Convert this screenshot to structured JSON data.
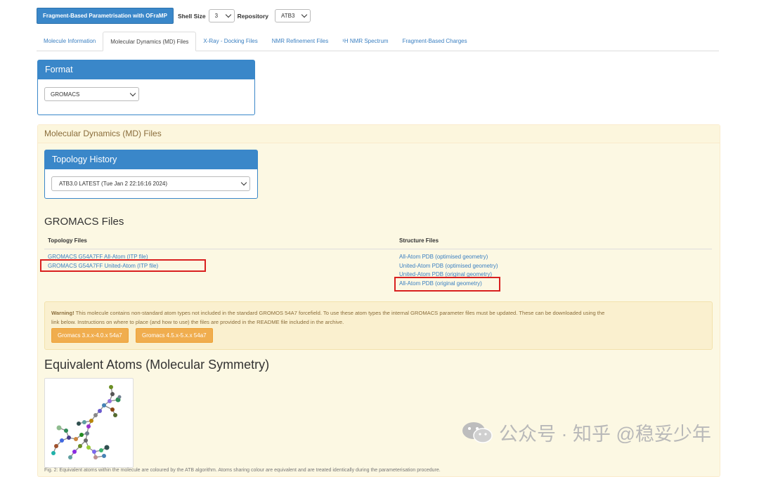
{
  "toolbar": {
    "fragment_button": "Fragment-Based Parametrisation with OFraMP",
    "shell_size_label": "Shell Size",
    "shell_size_value": "3",
    "repository_label": "Repository",
    "repository_value": "ATB3"
  },
  "tabs": [
    {
      "label": "Molecule Information",
      "active": false
    },
    {
      "label": "Molecular Dynamics (MD) Files",
      "active": true
    },
    {
      "label": "X-Ray - Docking Files",
      "active": false
    },
    {
      "label": "NMR Refinement Files",
      "active": false
    },
    {
      "label": "¹H NMR Spectrum",
      "active": false
    },
    {
      "label": "Fragment-Based Charges",
      "active": false
    }
  ],
  "format": {
    "title": "Format",
    "value": "GROMACS"
  },
  "md_panel": {
    "title": "Molecular Dynamics (MD) Files"
  },
  "topology_history": {
    "title": "Topology History",
    "value": "ATB3.0 LATEST (Tue Jan 2 22:16:16 2024)"
  },
  "gromacs_files": {
    "title": "GROMACS Files",
    "topology_header": "Topology Files",
    "structure_header": "Structure Files",
    "topology_links": [
      "GROMACS G54A7FF All-Atom (ITP file)",
      "GROMACS G54A7FF United-Atom (ITP file)"
    ],
    "structure_links": [
      "All-Atom PDB (optimised geometry)",
      "United-Atom PDB (optimised geometry)",
      "United-Atom PDB (original geometry)",
      "All-Atom PDB (original geometry)"
    ]
  },
  "warning": {
    "bold": "Warning!",
    "line1": " This molecule contains non-standard atom types not included in the standard GROMOS 54A7 forcefield. To use these atom types the internal GROMACS parameter files must be updated. These can be downloaded using the",
    "line2": "link below. Instructions on where to place (and how to use) the files are provided in the README file included in the archive.",
    "button1": "Gromacs 3.x.x-4.0.x 54a7",
    "button2": "Gromacs 4.5.x-5.x.x 54a7"
  },
  "equivalent_atoms": {
    "title": "Equivalent Atoms (Molecular Symmetry)"
  },
  "watermark": {
    "text": "公众号 · 知乎 @稳妥少年"
  },
  "colors": {
    "primary": "#3a87c9",
    "link": "#3a7fc1",
    "warning_bg": "#fcf8e3",
    "orange_button": "#f0ad4e",
    "highlight_box": "#d9201f"
  }
}
